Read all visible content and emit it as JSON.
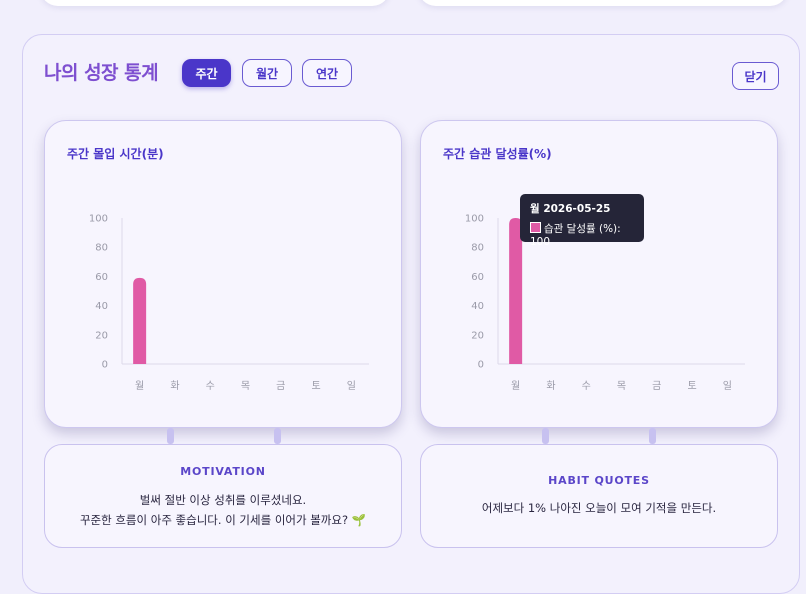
{
  "header": {
    "title": "나의 성장 통계",
    "tabs": [
      {
        "label": "주간",
        "active": true
      },
      {
        "label": "월간",
        "active": false
      },
      {
        "label": "연간",
        "active": false
      }
    ],
    "close_label": "닫기"
  },
  "chart_data": [
    {
      "type": "bar",
      "title": "주간 몰입 시간(분)",
      "categories": [
        "월",
        "화",
        "수",
        "목",
        "금",
        "토",
        "일"
      ],
      "values": [
        59,
        0,
        0,
        0,
        0,
        0,
        0
      ],
      "ylim": [
        0,
        100
      ],
      "yticks": [
        "0",
        "20",
        "40",
        "60",
        "80",
        "100"
      ],
      "color": "#e05aa5",
      "grid": false
    },
    {
      "type": "bar",
      "title": "주간 습관 달성률(%)",
      "categories": [
        "월",
        "화",
        "수",
        "목",
        "금",
        "토",
        "일"
      ],
      "values": [
        100,
        0,
        0,
        0,
        0,
        0,
        0
      ],
      "ylim": [
        0,
        100
      ],
      "yticks": [
        "0",
        "20",
        "40",
        "60",
        "80",
        "100"
      ],
      "color": "#e05aa5",
      "grid": false,
      "tooltip": {
        "title": "월 2026-05-25",
        "label": "습관 달성률 (%): 100"
      }
    }
  ],
  "motivation": {
    "heading": "MOTIVATION",
    "line1": "벌써 절반 이상 성취를 이루셨네요.",
    "line2": "꾸준한 흐름이 아주 좋습니다. 이 기세를 이어가 볼까요? 🌱"
  },
  "habit_quotes": {
    "heading": "HABIT QUOTES",
    "text": "어제보다 1% 나아진 오늘이 모여 기적을 만든다."
  }
}
